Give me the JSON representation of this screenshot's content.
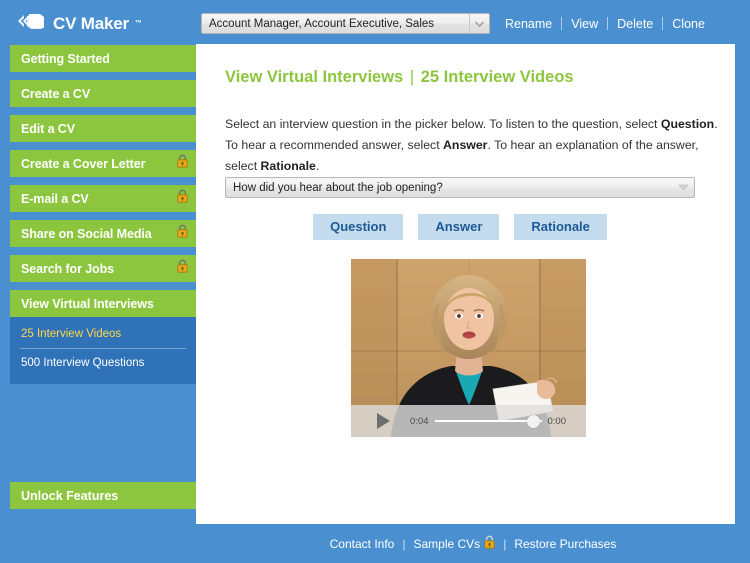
{
  "colors": {
    "app_bg": "#4a90d0",
    "nav_green": "#8cc63e",
    "submenu_blue": "#2f72b8",
    "active_yellow": "#ffd84a",
    "panel_white": "#ffffff",
    "button_blue_bg": "#c5dcee",
    "button_blue_text": "#1c5a96",
    "lock_gold": "#e3a81b"
  },
  "sidebar": {
    "logo": {
      "text": "CV Maker",
      "tm": "™",
      "icon": "pages-chevron-icon"
    },
    "items": [
      {
        "label": "Getting Started",
        "locked": false
      },
      {
        "label": "Create a CV",
        "locked": false
      },
      {
        "label": "Edit a CV",
        "locked": false
      },
      {
        "label": "Create a Cover Letter",
        "locked": true
      },
      {
        "label": "E-mail a CV",
        "locked": true
      },
      {
        "label": "Share on Social Media",
        "locked": true
      },
      {
        "label": "Search for Jobs",
        "locked": true
      },
      {
        "label": "View Virtual Interviews",
        "locked": false
      }
    ],
    "submenu": [
      {
        "label": "25 Interview Videos",
        "active": true
      },
      {
        "label": "500 Interview Questions",
        "active": false
      }
    ],
    "unlock_label": "Unlock Features"
  },
  "topbar": {
    "cv_select": {
      "value": "Account Manager, Account Executive, Sales",
      "icon": "chevron-down-icon"
    },
    "links": [
      "Rename",
      "View",
      "Delete",
      "Clone"
    ]
  },
  "main": {
    "title_primary": "View Virtual Interviews",
    "title_divider": "|",
    "title_secondary": "25 Interview Videos",
    "description": {
      "p1": "Select an interview question in the picker below. To listen to the question, select ",
      "b1": "Question",
      "p2": ". To hear a recommended answer, select ",
      "b2": "Answer",
      "p3": ". To hear an explanation of the answer, select ",
      "b3": "Rationale",
      "p4": "."
    },
    "question_picker": {
      "value": "How did you hear about the job opening?",
      "icon": "chevron-down-icon"
    },
    "audio_buttons": [
      "Question",
      "Answer",
      "Rationale"
    ],
    "video": {
      "play_icon": "play-icon",
      "time_elapsed": "0:04",
      "time_remaining": "0:00",
      "scrubber_position_pct": 100
    }
  },
  "footer": {
    "links": [
      {
        "label": "Contact Info",
        "locked": false
      },
      {
        "label": "Sample CVs",
        "locked": true
      },
      {
        "label": "Restore Purchases",
        "locked": false
      }
    ],
    "separator": "|"
  }
}
